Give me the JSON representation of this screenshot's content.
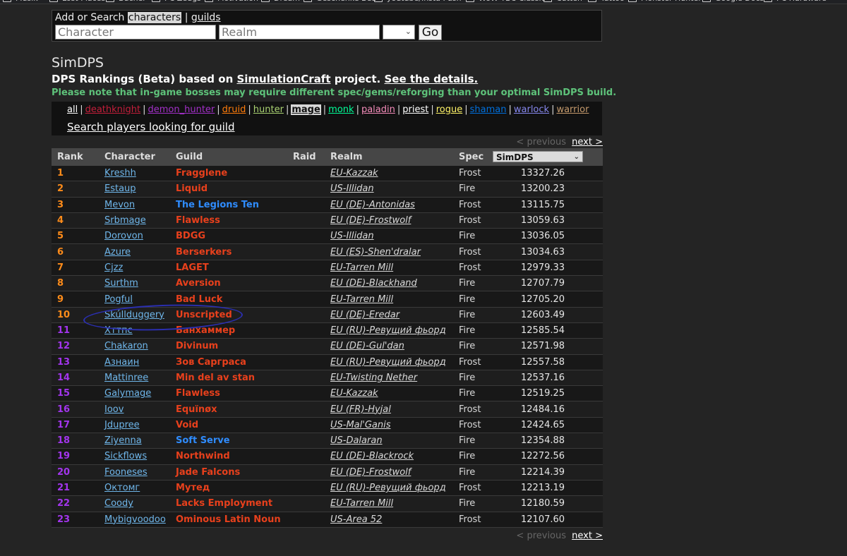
{
  "bookmarks": [
    {
      "label": "Musik"
    },
    {
      "label": "Lost Places"
    },
    {
      "label": "Bücher"
    },
    {
      "label": "PC Zeugs"
    },
    {
      "label": "Motivation"
    },
    {
      "label": "Dream"
    },
    {
      "label": "Geschenke Bea"
    },
    {
      "label": "youtube/Insta Push"
    },
    {
      "label": "WoW TBC Classic"
    },
    {
      "label": "Cutten"
    },
    {
      "label": "Tattoo"
    },
    {
      "label": "Monster Hunter"
    },
    {
      "label": "Google Docs"
    },
    {
      "label": "PC Hardware"
    }
  ],
  "search": {
    "title_prefix": "Add or Search",
    "characters_link": "characters",
    "separator": "|",
    "guilds_link": "guilds",
    "character_placeholder": "Character",
    "realm_placeholder": "Realm",
    "region_value": "",
    "go_label": "Go"
  },
  "header": {
    "title": "SimDPS",
    "subtitle_prefix": "DPS Rankings (Beta) based on ",
    "simc_link": "SimulationCraft",
    "subtitle_mid": " project. ",
    "details_link": "See the details.",
    "note": "Please note that in-game bosses may require different spec/gems/reforging than your optimal SimDPS build."
  },
  "class_filter": {
    "classes": [
      {
        "label": "all",
        "color": "#ffffff"
      },
      {
        "label": "deathknight",
        "color": "#c41e3a"
      },
      {
        "label": "demon_hunter",
        "color": "#a330c9"
      },
      {
        "label": "druid",
        "color": "#ff7c0a"
      },
      {
        "label": "hunter",
        "color": "#aad372"
      },
      {
        "label": "mage",
        "color": "#3fc7eb",
        "active": true
      },
      {
        "label": "monk",
        "color": "#00ff98"
      },
      {
        "label": "paladin",
        "color": "#f48cba"
      },
      {
        "label": "priest",
        "color": "#ffffff"
      },
      {
        "label": "rogue",
        "color": "#fff468"
      },
      {
        "label": "shaman",
        "color": "#0070dd"
      },
      {
        "label": "warlock",
        "color": "#8788ee"
      },
      {
        "label": "warrior",
        "color": "#c69b6d"
      }
    ],
    "looking_for_guild": "Search players looking for guild"
  },
  "pager": {
    "previous": "< previous",
    "next": "next >"
  },
  "table": {
    "headers": {
      "rank": "Rank",
      "character": "Character",
      "guild": "Guild",
      "raid": "Raid",
      "realm": "Realm",
      "spec": "Spec",
      "sort_select": "SimDPS"
    },
    "colors": {
      "rank_orange": "#ff8c1a",
      "rank_purple": "#a335ee",
      "guild_red": "#e8401c",
      "guild_blue": "#2f8cff"
    },
    "rows": [
      {
        "rank": "1",
        "character": "Kreshh",
        "guild": "Fragglene",
        "guild_color": "red",
        "raid": "",
        "realm": "EU-Kazzak",
        "spec": "Frost",
        "dps": "13327.26",
        "rank_color": "orange"
      },
      {
        "rank": "2",
        "character": "Estaup",
        "guild": "Liquid",
        "guild_color": "red",
        "raid": "",
        "realm": "US-Illidan",
        "spec": "Fire",
        "dps": "13200.23",
        "rank_color": "orange"
      },
      {
        "rank": "3",
        "character": "Mevon",
        "guild": "The Legions Ten",
        "guild_color": "blue",
        "raid": "",
        "realm": "EU (DE)-Antonidas",
        "spec": "Frost",
        "dps": "13115.75",
        "rank_color": "orange"
      },
      {
        "rank": "4",
        "character": "Srbmage",
        "guild": "Flawless",
        "guild_color": "red",
        "raid": "",
        "realm": "EU (DE)-Frostwolf",
        "spec": "Frost",
        "dps": "13059.63",
        "rank_color": "orange"
      },
      {
        "rank": "5",
        "character": "Dorovon",
        "guild": "BDGG",
        "guild_color": "red",
        "raid": "",
        "realm": "US-Illidan",
        "spec": "Fire",
        "dps": "13036.05",
        "rank_color": "orange"
      },
      {
        "rank": "6",
        "character": "Azure",
        "guild": "Berserkers",
        "guild_color": "red",
        "raid": "",
        "realm": "EU (ES)-Shen'dralar",
        "spec": "Frost",
        "dps": "13034.63",
        "rank_color": "orange"
      },
      {
        "rank": "7",
        "character": "Cjzz",
        "guild": "LAGET",
        "guild_color": "red",
        "raid": "",
        "realm": "EU-Tarren Mill",
        "spec": "Frost",
        "dps": "12979.33",
        "rank_color": "orange"
      },
      {
        "rank": "8",
        "character": "Surthm",
        "guild": "Aversion",
        "guild_color": "red",
        "raid": "",
        "realm": "EU (DE)-Blackhand",
        "spec": "Fire",
        "dps": "12707.79",
        "rank_color": "orange"
      },
      {
        "rank": "9",
        "character": "Pogful",
        "guild": "Bad Luck",
        "guild_color": "red",
        "raid": "",
        "realm": "EU-Tarren Mill",
        "spec": "Fire",
        "dps": "12705.20",
        "rank_color": "orange"
      },
      {
        "rank": "10",
        "character": "Skúllduggery",
        "guild": "Unscripted",
        "guild_color": "red",
        "raid": "",
        "realm": "EU (DE)-Eredar",
        "spec": "Fire",
        "dps": "12603.49",
        "rank_color": "orange"
      },
      {
        "rank": "11",
        "character": "Хттпс",
        "guild": "Банхаммер",
        "guild_color": "red",
        "raid": "",
        "realm": "EU (RU)-Ревущий фьорд",
        "spec": "Fire",
        "dps": "12585.54",
        "rank_color": "purple"
      },
      {
        "rank": "12",
        "character": "Chakaron",
        "guild": "Divinum",
        "guild_color": "red",
        "raid": "",
        "realm": "EU (DE)-Gul'dan",
        "spec": "Fire",
        "dps": "12571.98",
        "rank_color": "purple"
      },
      {
        "rank": "13",
        "character": "Азнаин",
        "guild": "Зов Сарграса",
        "guild_color": "red",
        "raid": "",
        "realm": "EU (RU)-Ревущий фьорд",
        "spec": "Frost",
        "dps": "12557.58",
        "rank_color": "purple"
      },
      {
        "rank": "14",
        "character": "Mattinree",
        "guild": "Min del av stan",
        "guild_color": "red",
        "raid": "",
        "realm": "EU-Twisting Nether",
        "spec": "Fire",
        "dps": "12537.16",
        "rank_color": "purple"
      },
      {
        "rank": "15",
        "character": "Galymage",
        "guild": "Flawless",
        "guild_color": "red",
        "raid": "",
        "realm": "EU-Kazzak",
        "spec": "Fire",
        "dps": "12519.25",
        "rank_color": "purple"
      },
      {
        "rank": "16",
        "character": "Ioov",
        "guild": "Equïnøx",
        "guild_color": "red",
        "raid": "",
        "realm": "EU (FR)-Hyjal",
        "spec": "Frost",
        "dps": "12484.16",
        "rank_color": "purple"
      },
      {
        "rank": "17",
        "character": "Jdupree",
        "guild": "Void",
        "guild_color": "red",
        "raid": "",
        "realm": "US-Mal'Ganis",
        "spec": "Frost",
        "dps": "12424.65",
        "rank_color": "purple"
      },
      {
        "rank": "18",
        "character": "Ziyenna",
        "guild": "Soft Serve",
        "guild_color": "blue",
        "raid": "",
        "realm": "US-Dalaran",
        "spec": "Fire",
        "dps": "12354.88",
        "rank_color": "purple"
      },
      {
        "rank": "19",
        "character": "Sickflows",
        "guild": "Northwind",
        "guild_color": "red",
        "raid": "",
        "realm": "EU (DE)-Blackrock",
        "spec": "Fire",
        "dps": "12272.56",
        "rank_color": "purple"
      },
      {
        "rank": "20",
        "character": "Fooneses",
        "guild": "Jade Falcons",
        "guild_color": "red",
        "raid": "",
        "realm": "EU (DE)-Frostwolf",
        "spec": "Fire",
        "dps": "12214.39",
        "rank_color": "purple"
      },
      {
        "rank": "21",
        "character": "Октомг",
        "guild": "Мутед",
        "guild_color": "red",
        "raid": "",
        "realm": "EU (RU)-Ревущий фьорд",
        "spec": "Frost",
        "dps": "12213.19",
        "rank_color": "purple"
      },
      {
        "rank": "22",
        "character": "Coody",
        "guild": "Lacks Employment",
        "guild_color": "red",
        "raid": "",
        "realm": "EU-Tarren Mill",
        "spec": "Fire",
        "dps": "12180.59",
        "rank_color": "purple"
      },
      {
        "rank": "23",
        "character": "Mybigvoodoo",
        "guild": "Ominous Latin Noun",
        "guild_color": "red",
        "raid": "",
        "realm": "US-Area 52",
        "spec": "Frost",
        "dps": "12107.60",
        "rank_color": "purple"
      }
    ]
  }
}
